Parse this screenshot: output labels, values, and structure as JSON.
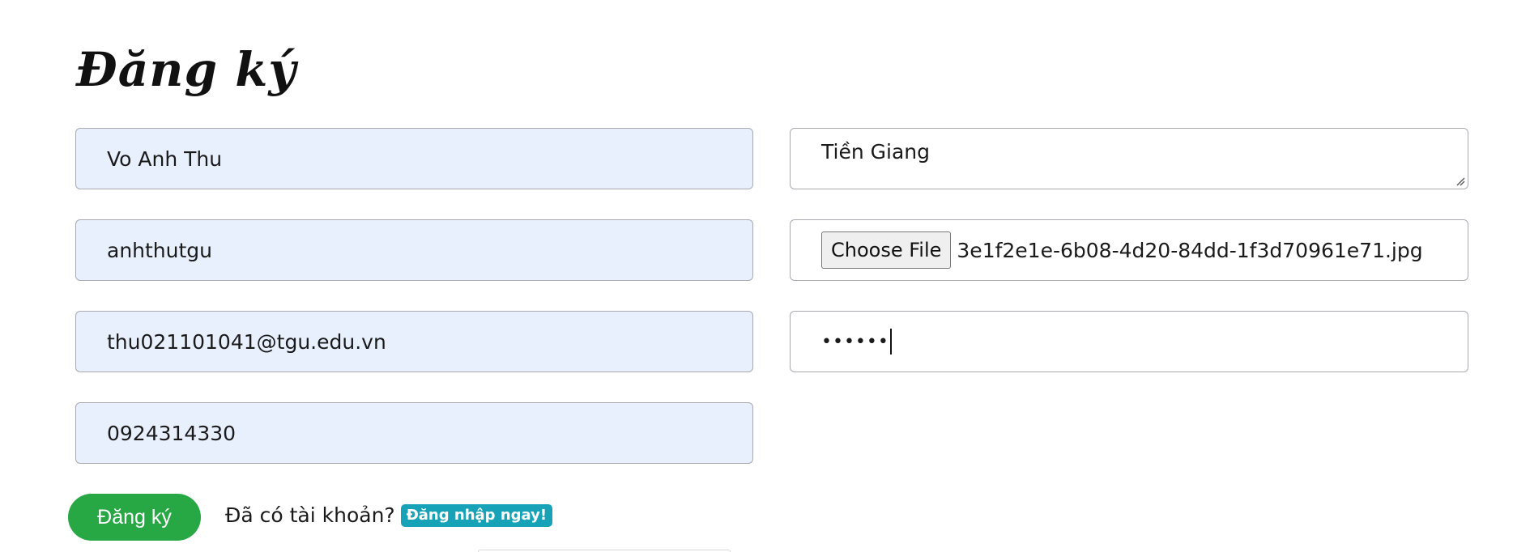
{
  "page_title": "Đăng ký",
  "form": {
    "fullname": {
      "value": "Vo Anh Thu"
    },
    "username": {
      "value": "anhthutgu"
    },
    "email": {
      "value": "thu021101041@tgu.edu.vn"
    },
    "phone": {
      "value": "0924314330"
    },
    "address": {
      "value": "Tiền Giang"
    },
    "avatar": {
      "button_label": "Choose File",
      "file_name": "3e1f2e1e-6b08-4d20-84dd-1f3d70961e71.jpg"
    },
    "password": {
      "masked_value": "••••••"
    }
  },
  "actions": {
    "submit_label": "Đăng ký",
    "have_account_text": "Đã có tài khoản?",
    "login_link_label": "Đăng nhập ngay!"
  },
  "colors": {
    "autofill_bg": "#e8f0fe",
    "submit_bg": "#28a745",
    "badge_bg": "#17a2b8"
  },
  "icons": {
    "textarea_resize": "resize-grip-icon"
  }
}
